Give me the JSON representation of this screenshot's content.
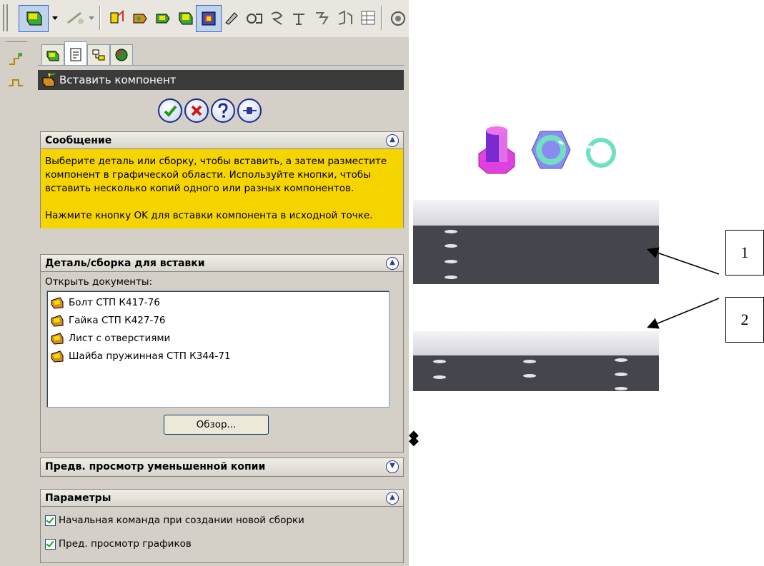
{
  "panel": {
    "title": "Вставить компонент",
    "message_section": {
      "header": "Сообщение",
      "text_1": "Выберите деталь или сборку, чтобы вставить, а затем разместите компонент в графической области. Используйте кнопки, чтобы вставить несколько копий одного или разных компонентов.",
      "text_2": "Нажмите кнопку OK для вставки компонента в исходной точке."
    },
    "part_section": {
      "header": "Деталь/сборка для вставки",
      "open_docs_label": "Открыть документы:",
      "documents": [
        "Болт   СТП К417-76",
        "Гайка   СТП К427-76",
        "Лист с отверстиями",
        "Шайба пружинная   СТП К344-71"
      ],
      "browse_label": "Обзор..."
    },
    "preview_section": {
      "header": "Предв. просмотр уменьшенной копии"
    },
    "options_section": {
      "header": "Параметры",
      "option_1": "Начальная команда при создании новой сборки",
      "option_2": "Пред. просмотр графиков"
    }
  },
  "callouts": {
    "label_1": "1",
    "label_2": "2"
  },
  "icons": [
    "ok-check-icon",
    "cancel-x-icon",
    "help-icon",
    "pushpin-icon"
  ],
  "colors": {
    "title_bar": "#3b3b3b",
    "message_bg": "#f6d400",
    "panel_bg": "#d4d0c8",
    "bolt": "#e040e0",
    "nut": "#70e0c0",
    "washer": "#70e0c0",
    "plate": "#45454d"
  }
}
